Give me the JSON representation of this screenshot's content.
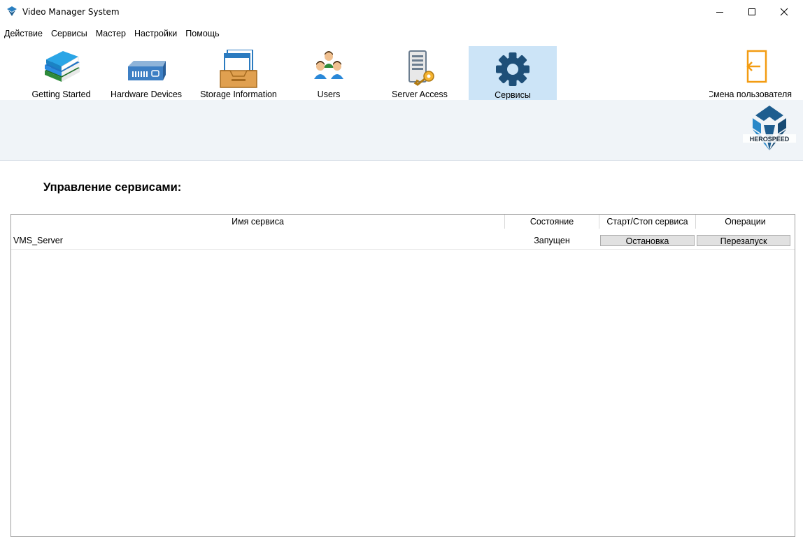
{
  "window": {
    "title": "Video Manager System"
  },
  "menu": [
    "Действие",
    "Сервисы",
    "Мастер",
    "Настройки",
    "Помощь"
  ],
  "toolbar": {
    "items": [
      {
        "label": "Getting Started",
        "icon": "books-icon"
      },
      {
        "label": "Hardware Devices",
        "icon": "nvr-device-icon"
      },
      {
        "label": "Storage Information",
        "icon": "storage-tray-icon"
      },
      {
        "label": "Users",
        "icon": "users-icon"
      },
      {
        "label": "Server Access",
        "icon": "server-key-icon"
      },
      {
        "label": "Сервисы",
        "icon": "gear-icon",
        "active": true
      }
    ],
    "switch_user_label": "Смена пользователя"
  },
  "logo_text": "HEROSPEED",
  "heading": "Управление сервисами:",
  "table": {
    "columns": [
      "Имя сервиса",
      "Состояние",
      "Старт/Стоп сервиса",
      "Операции"
    ],
    "rows": [
      {
        "name": "VMS_Server",
        "state": "Запущен",
        "start_stop": "Остановка",
        "operation": "Перезапуск"
      }
    ]
  },
  "colors": {
    "active_tab": "#cce4f7",
    "gear": "#1e4f78",
    "accent_orange": "#f39c12"
  }
}
